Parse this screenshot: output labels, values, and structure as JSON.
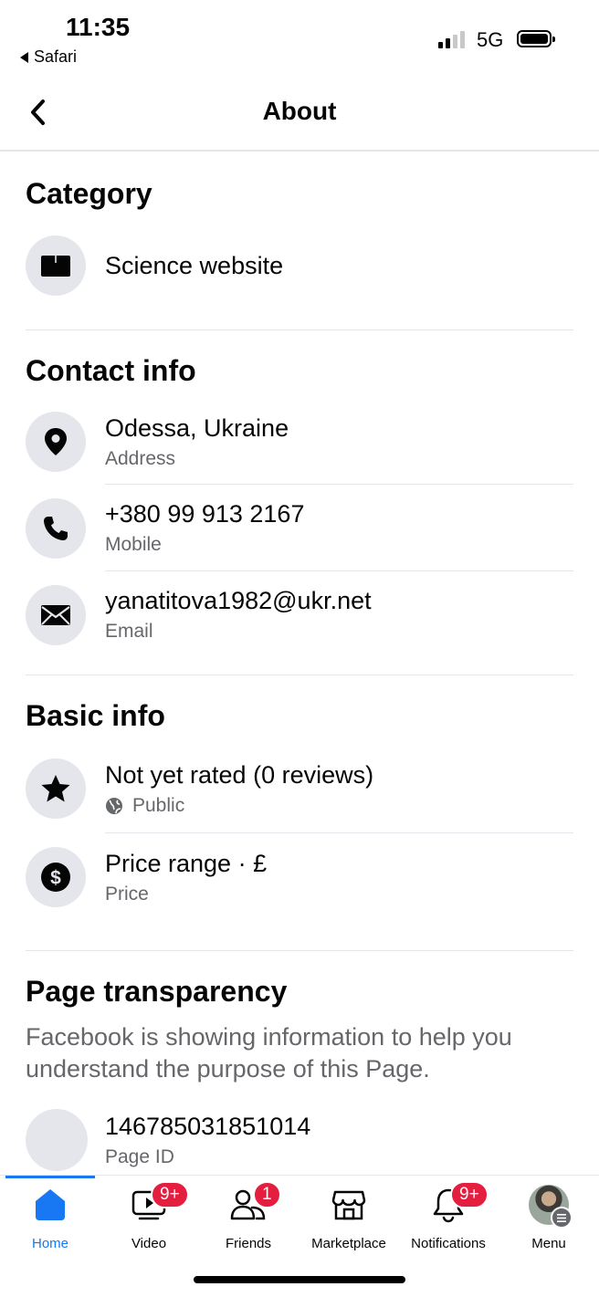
{
  "status_bar": {
    "time": "11:35",
    "back_app": "Safari",
    "network": "5G"
  },
  "nav": {
    "title": "About"
  },
  "category": {
    "title": "Category",
    "item": {
      "label": "Science website",
      "icon": "book-icon"
    }
  },
  "contact": {
    "title": "Contact info",
    "items": [
      {
        "value": "Odessa, Ukraine",
        "label": "Address",
        "icon": "location-pin-icon"
      },
      {
        "value": "+380 99 913 2167",
        "label": "Mobile",
        "icon": "phone-icon"
      },
      {
        "value": "yanatitova1982@ukr.net",
        "label": "Email",
        "icon": "envelope-icon"
      }
    ]
  },
  "basic": {
    "title": "Basic info",
    "items": [
      {
        "value": "Not yet rated (0 reviews)",
        "label": "Public",
        "icon": "star-icon"
      },
      {
        "value": "Price range · £",
        "label": "Price",
        "icon": "dollar-icon"
      }
    ]
  },
  "transparency": {
    "title": "Page transparency",
    "description": "Facebook is showing information to help you understand the purpose of this Page.",
    "page_id": {
      "value": "146785031851014",
      "label": "Page ID"
    }
  },
  "tabs": [
    {
      "label": "Home",
      "icon": "home-icon",
      "active": true
    },
    {
      "label": "Video",
      "icon": "video-icon",
      "badge": "9+"
    },
    {
      "label": "Friends",
      "icon": "friends-icon",
      "badge": "1"
    },
    {
      "label": "Marketplace",
      "icon": "marketplace-icon"
    },
    {
      "label": "Notifications",
      "icon": "bell-icon",
      "badge": "9+"
    },
    {
      "label": "Menu",
      "icon": "avatar-icon"
    }
  ],
  "colors": {
    "accent": "#1877f2",
    "badge": "#e41e3f",
    "icon_bg": "#e4e6eb",
    "secondary_text": "#65676b"
  }
}
